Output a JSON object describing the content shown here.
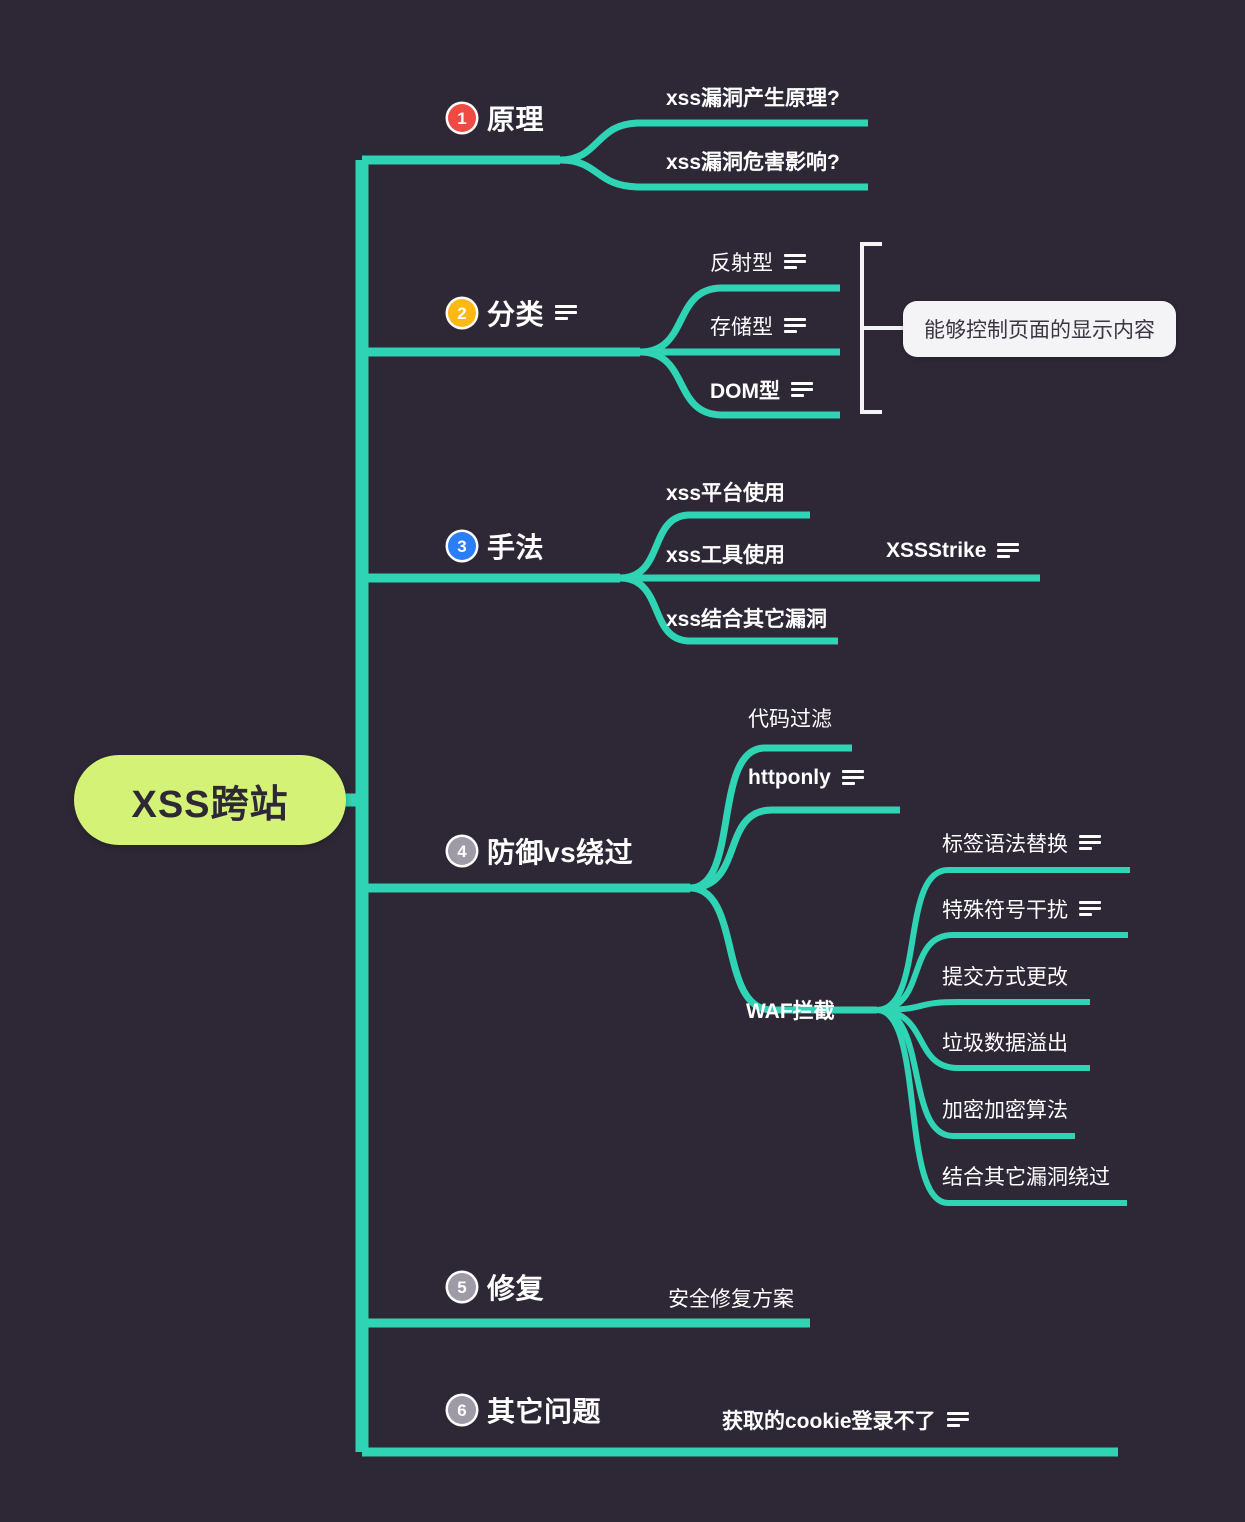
{
  "mindmap": {
    "root": {
      "label": "XSS跨站"
    },
    "branches": [
      {
        "number": "1",
        "label": "原理",
        "badge_color": "#ef4a43",
        "has_note": false,
        "children": [
          {
            "label": "xss漏洞产生原理?",
            "has_note": false
          },
          {
            "label": "xss漏洞危害影响?",
            "has_note": false
          }
        ]
      },
      {
        "number": "2",
        "label": "分类",
        "badge_color": "#fdb913",
        "has_note": true,
        "children": [
          {
            "label": "反射型",
            "has_note": true
          },
          {
            "label": "存储型",
            "has_note": true
          },
          {
            "label": "DOM型",
            "has_note": true
          }
        ],
        "group_callout": "能够控制页面的显示内容"
      },
      {
        "number": "3",
        "label": "手法",
        "badge_color": "#2b7ef5",
        "has_note": false,
        "children": [
          {
            "label": "xss平台使用",
            "has_note": false
          },
          {
            "label": "xss工具使用",
            "has_note": false,
            "children": [
              {
                "label": "XSSStrike",
                "has_note": true
              }
            ]
          },
          {
            "label": "xss结合其它漏洞",
            "has_note": false
          }
        ]
      },
      {
        "number": "4",
        "label": "防御vs绕过",
        "badge_color": "#9e9aa6",
        "has_note": false,
        "children": [
          {
            "label": "代码过滤",
            "has_note": false
          },
          {
            "label": "httponly",
            "has_note": true
          },
          {
            "label": "WAF拦截",
            "has_note": false,
            "children": [
              {
                "label": "标签语法替换",
                "has_note": true
              },
              {
                "label": "特殊符号干扰",
                "has_note": true
              },
              {
                "label": "提交方式更改",
                "has_note": false
              },
              {
                "label": "垃圾数据溢出",
                "has_note": false
              },
              {
                "label": "加密加密算法",
                "has_note": false
              },
              {
                "label": "结合其它漏洞绕过",
                "has_note": false
              }
            ]
          }
        ]
      },
      {
        "number": "5",
        "label": "修复",
        "badge_color": "#9e9aa6",
        "has_note": false,
        "children": [
          {
            "label": "安全修复方案",
            "has_note": false
          }
        ]
      },
      {
        "number": "6",
        "label": "其它问题",
        "badge_color": "#9e9aa6",
        "has_note": false,
        "children": [
          {
            "label": "获取的cookie登录不了",
            "has_note": true
          }
        ]
      }
    ],
    "colors": {
      "background": "#2e2836",
      "wire": "#2ed4b4",
      "root_fill": "#d3f276",
      "root_text": "#2e2836",
      "text": "#ffffff",
      "callout_fill": "#f4f3f5",
      "callout_text": "#3b3544"
    }
  }
}
